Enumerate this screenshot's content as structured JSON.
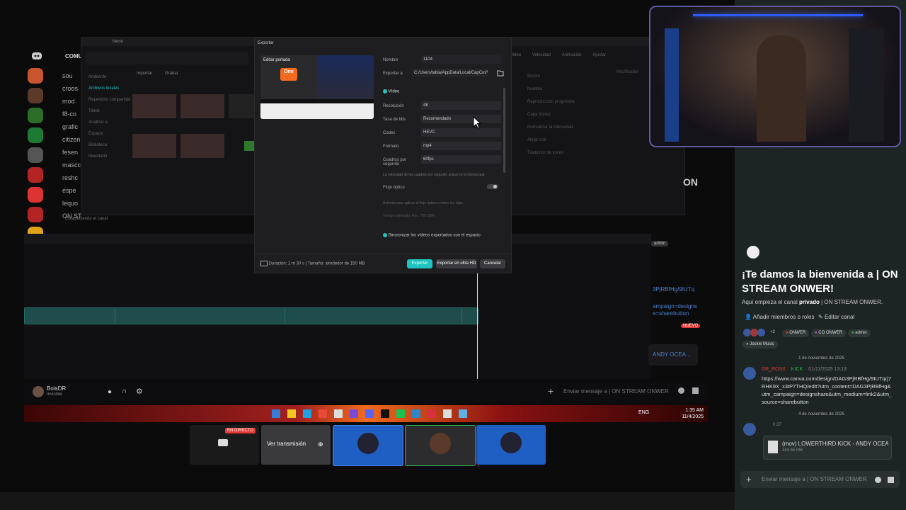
{
  "discord": {
    "guild_label": "COMU",
    "channels": [
      "sou",
      "croos",
      "mod",
      "f8-co",
      "grafic",
      "citizen",
      "fesen",
      "mascc",
      "reshc",
      "espe",
      "lequo",
      "ON ST"
    ],
    "channel_status": "Estableciendo el canal"
  },
  "capcut": {
    "menu": "Menú",
    "tabs": [
      "Importar",
      "Grabar"
    ],
    "left_nav": [
      "Ambiente",
      "Archivos locales",
      "Repertorio compartido",
      "Tiktok",
      "Analizar a",
      "Espacio",
      "Biblioteca",
      "Inventario"
    ],
    "right_tabs": [
      "Video",
      "Velocidad",
      "Animación",
      "Ajustar"
    ],
    "right_labels": [
      "Básico",
      "Modificador",
      "Nombre",
      "Reproducción progresiva",
      "Capa frontal",
      "Normalizar la intensidad",
      "Alejar voz",
      "Traductor de voces"
    ]
  },
  "dialog": {
    "title": "Exportar",
    "edit_cover": "Editar portada",
    "cover_logo": "One",
    "name_label": "Nombre",
    "name_value": "1104",
    "export_label": "Exportar a",
    "export_path": "C:/Users/tabia/AppData/Local/CapCut/Vi...",
    "video_section": "Vídeo",
    "resolution_label": "Resolución",
    "resolution_value": "4K",
    "bitrate_label": "Tasa de bits",
    "bitrate_value": "Recomendado",
    "codec_label": "Codec",
    "codec_value": "HEVC",
    "format_label": "Formato",
    "format_value": "mp4",
    "fps_label": "Cuadros por segundo",
    "fps_value": "60fps",
    "fps_hint": "La velocidad de los cuadros por segundo actual es la misma que",
    "optical_label": "Flujo óptico",
    "optical_hint": "Actívalo para aplicar el flujo óptico a todos los clips.",
    "optical_extra": "Tiempo estimado: Rec. 709 SDR",
    "sync_label": "Sincronizar los vídeos exportados con el espacio",
    "duration": "Duración: 1 m 30 s | Tamaño: alrededor de 150 MB",
    "btn_export": "Exportar",
    "btn_export_hd": "Exportar en ultra HD",
    "btn_cancel": "Cancelar"
  },
  "overlay": {
    "ON_fragment": "ON",
    "links": "3PjRBfHg/9IUTq",
    "campaign": "ampaign=designs",
    "sharebutton": "e=sharebutton",
    "live": "NUEVO",
    "andy": "ANDY OCEA...",
    "admin_tag": "admin"
  },
  "userbar": {
    "username": "BoisDR",
    "status": "Invisible",
    "message_placeholder": "Enviar mensaje a | ON STREAM ONWER"
  },
  "taskbar": {
    "lang": "ENG",
    "time": "1:35 AM",
    "date": "11/4/2025"
  },
  "stream_tiles": {
    "live_badge": "EN DIRECTO",
    "view_stream": "Ver transmisión"
  },
  "right_panel": {
    "welcome_title": "¡Te damos la bienvenida a | ON STREAM ONWER!",
    "welcome_sub_pre": "Aquí empieza el canal",
    "welcome_sub_bold": "privado",
    "welcome_sub_post": "| ON STREAM ONWER.",
    "add_members": "Añadir miembros o roles",
    "edit_channel": "Editar canal",
    "plus_count": "+2",
    "roles": [
      "ONWER",
      "CO ONWER",
      "admin"
    ],
    "bot_role": "Jockie Music",
    "date1": "1 de noviembre de 2025",
    "msg1_user": "DR_ROSS",
    "msg1_badge": "KICK",
    "msg1_time": "01/11/2025 13:13",
    "msg1_text": "https://www.canva.com/design/DAG3PjRBfHg/9IUTqrj7RHK9X_x3tP7THQ/edit?utm_content=DAG3PjRBfHg&utm_campaign=designshare&utm_medium=link2&utm_source=sharebutton",
    "date2": "4 de noviembre de 2025",
    "msg2_time": "0:27",
    "file_name": "(mov) LOWERTHIRD KICK - ANDY OCEAN...",
    "file_size": "444.65 MB",
    "input_placeholder": "Enviar mensaje a | ON STREAM ONWER"
  },
  "colors": {
    "accent_teal": "#1fc3c0",
    "discord_red": "#e53935",
    "tile_blue": "#1f5fc4"
  }
}
